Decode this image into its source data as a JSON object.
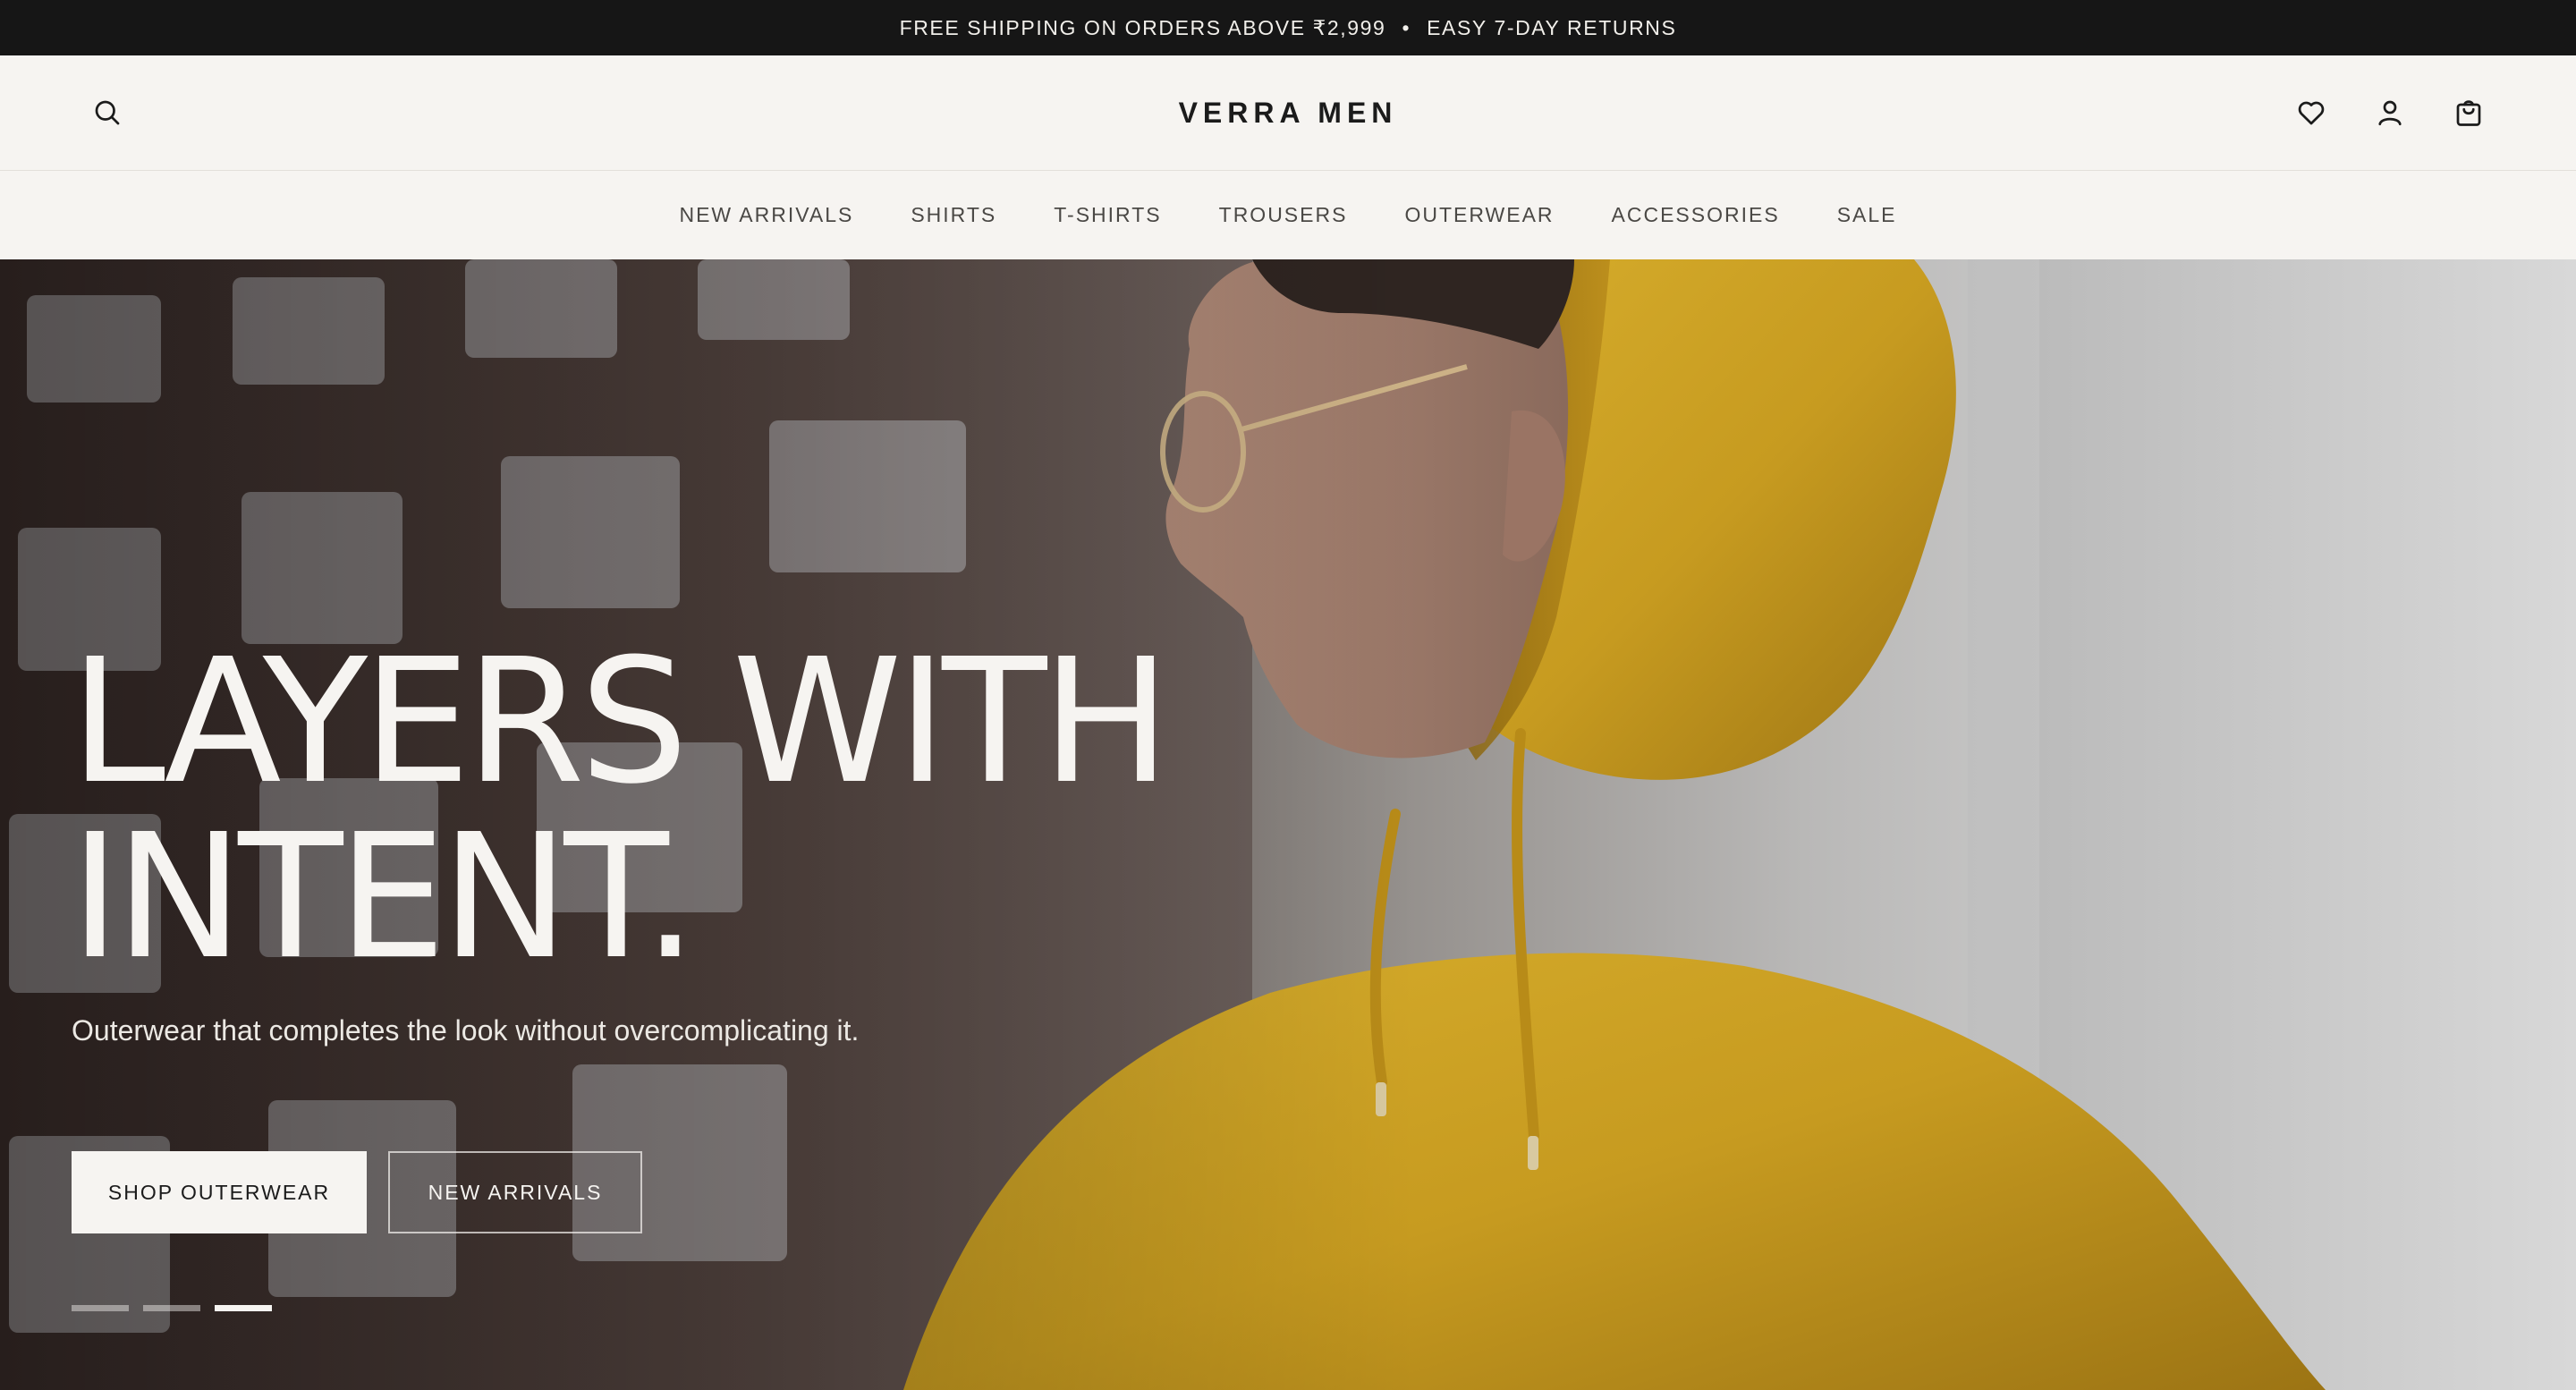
{
  "announcement": {
    "left": "FREE SHIPPING ON ORDERS ABOVE ₹2,999",
    "separator": "•",
    "right": "EASY 7-DAY RETURNS"
  },
  "header": {
    "brand": "VERRA MEN",
    "icons": [
      "search-icon",
      "heart-icon",
      "user-icon",
      "bag-icon"
    ]
  },
  "nav": {
    "items": [
      "NEW ARRIVALS",
      "SHIRTS",
      "T-SHIRTS",
      "TROUSERS",
      "OUTERWEAR",
      "ACCESSORIES",
      "SALE"
    ]
  },
  "hero": {
    "headline_line1": "LAYERS WITH",
    "headline_line2": "INTENT.",
    "subtext": "Outerwear that completes the look without overcomplicating it.",
    "primary_button": "SHOP OUTERWEAR",
    "secondary_button": "NEW ARRIVALS",
    "slides": {
      "total": 3,
      "active_index": 2
    }
  },
  "colors": {
    "announcement_bg": "#161616",
    "page_bg": "#f6f4f1",
    "text_dark": "#1b1b1b",
    "hoodie_yellow": "#c9a024"
  }
}
